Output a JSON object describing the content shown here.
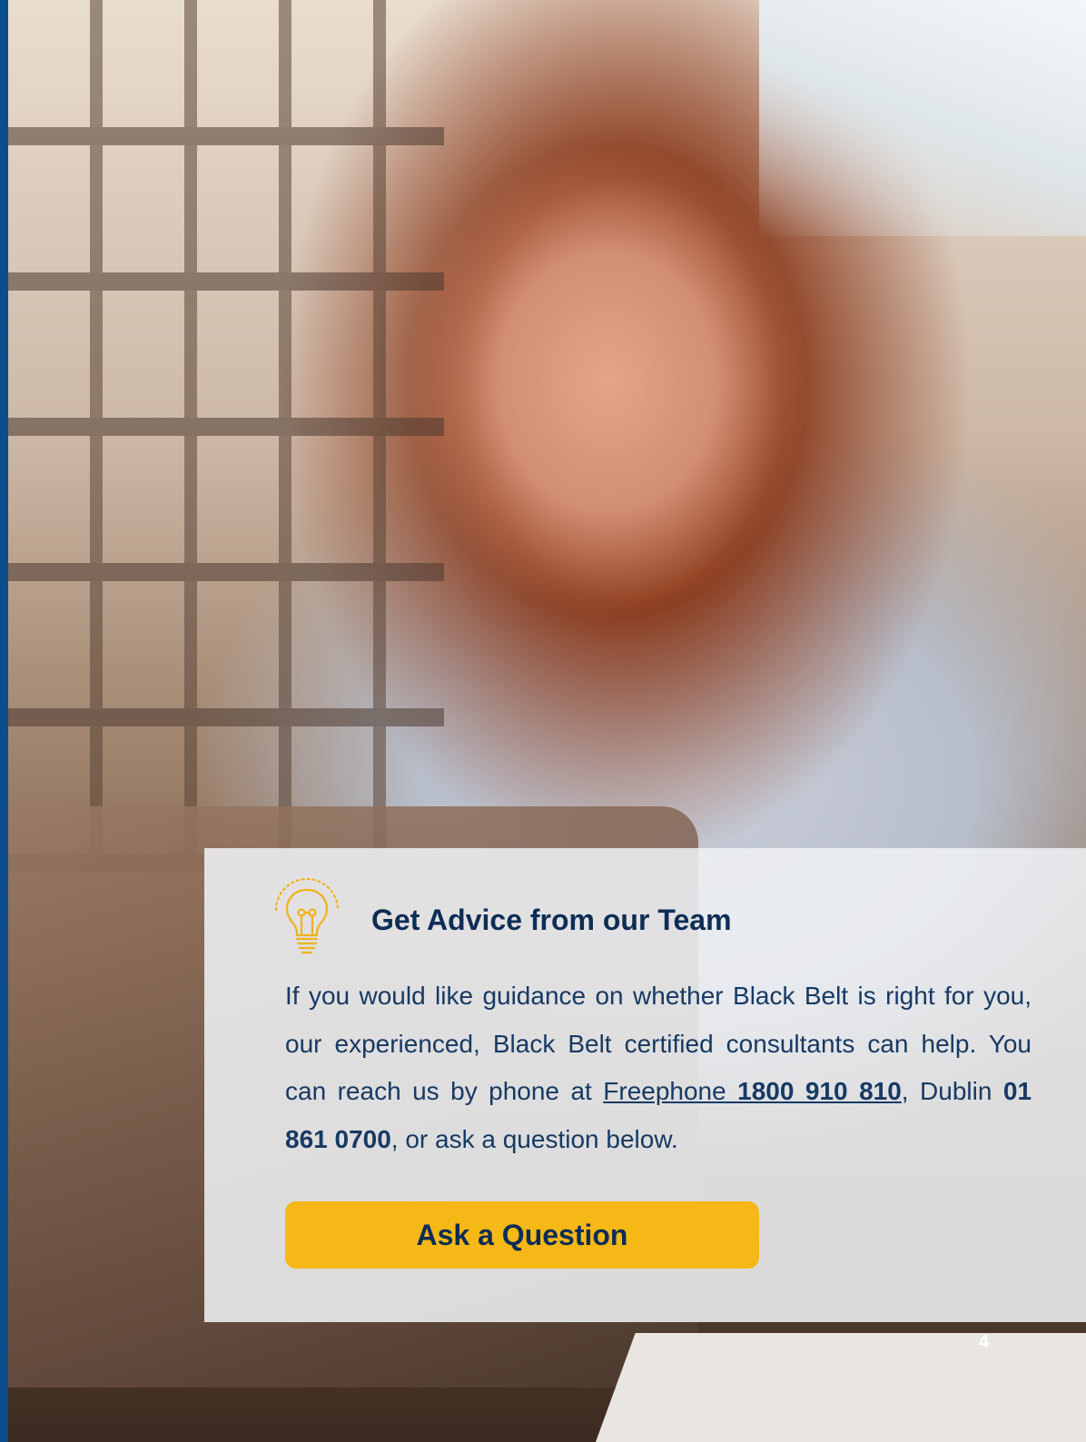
{
  "card": {
    "title": "Get Advice from our Team",
    "body_intro": "If you would like guidance on whether Black Belt is right for you, our experienced, Black Belt certified consultants can help. You can reach us by phone at ",
    "freephone_label": "Freephone ",
    "freephone_number": "1800 910 810",
    "sep1": ", Dublin ",
    "dublin_number": "01 861 0700",
    "body_outro": ", or ask a question below.",
    "button_label": "Ask a Question",
    "icon": "lightbulb-icon"
  },
  "page_number": "4",
  "colors": {
    "accent": "#f6b817",
    "heading": "#0d2d55",
    "stripe": "#0b4d8a"
  }
}
